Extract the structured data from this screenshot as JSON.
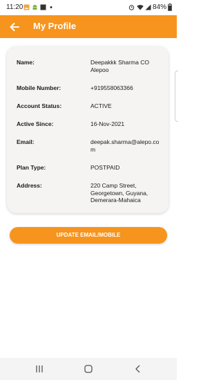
{
  "status_bar": {
    "time": "11:20",
    "battery": "84%",
    "icons": [
      "gallery-icon",
      "android-icon",
      "square-icon",
      "dot-icon",
      "alarm-icon",
      "wifi-icon",
      "signal-icon",
      "battery-icon"
    ]
  },
  "header": {
    "title": "My Profile",
    "back_icon": "arrow-left-icon",
    "color": "#f7941d"
  },
  "profile": {
    "rows": [
      {
        "label": "Name:",
        "value": "Deepakkk Sharma CO Alepoo"
      },
      {
        "label": "Mobile Number:",
        "value": "+919558063366"
      },
      {
        "label": "Account Status:",
        "value": "ACTIVE"
      },
      {
        "label": "Active Since:",
        "value": "16-Nov-2021"
      },
      {
        "label": "Email:",
        "value": "deepak.sharma@alepo.com"
      },
      {
        "label": "Plan Type:",
        "value": "POSTPAID"
      },
      {
        "label": "Address:",
        "value": "220 Camp Street, Georgetown, Guyana, Demerara-Mahaica"
      }
    ]
  },
  "actions": {
    "update_label": "UPDATE EMAIL/MOBILE"
  },
  "nav_bar": {
    "icons": [
      "recent-apps-icon",
      "home-icon",
      "back-icon"
    ]
  }
}
